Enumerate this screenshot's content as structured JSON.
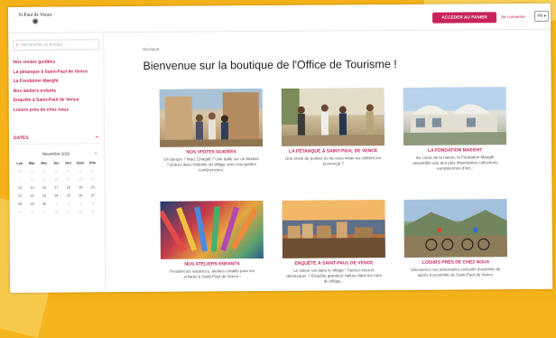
{
  "header": {
    "logo_text": "St Paul de Vence",
    "basket_button": "ACCÉDER AU PANIER",
    "login_link": "Se connecter",
    "language": "FR ▾"
  },
  "sidebar": {
    "search_placeholder": "Rechercher un produit",
    "nav_items": [
      "Nos visites guidées",
      "La pétanque à Saint-Paul de Vence",
      "La Fondation Maeght",
      "Nos ateliers enfants",
      "Enquête à Saint-Paul de Vence",
      "Loisirs près de chez nous"
    ],
    "dates_label": "DATES",
    "dates_toggle": "−",
    "calendar": {
      "month": "Novembre 2022",
      "next": "›",
      "weekdays": [
        "Lun",
        "Mar",
        "Mer",
        "Jeu",
        "Ven",
        "Sam",
        "Dim"
      ],
      "weeks": [
        [
          "31",
          "1",
          "2",
          "3",
          "4",
          "5",
          "6"
        ],
        [
          "7",
          "8",
          "9",
          "10",
          "11",
          "12",
          "13"
        ],
        [
          "14",
          "15",
          "16",
          "17",
          "18",
          "19",
          "20"
        ],
        [
          "21",
          "22",
          "23",
          "24",
          "25",
          "26",
          "27"
        ],
        [
          "28",
          "29",
          "30",
          "1",
          "2",
          "3",
          "4"
        ],
        [
          "5",
          "6",
          "7",
          "8",
          "9",
          "10",
          "11"
        ]
      ]
    }
  },
  "main": {
    "breadcrumb": "Boutique",
    "title": "Bienvenue sur la boutique de l'Office de Tourisme !",
    "cards": [
      {
        "title": "NOS VISITES GUIDÉES",
        "desc": "Un donjon ? Marc Chagall ? Une dalle sur un bastion ? Entrez dans l'intimité du village avec nos guides conférenciers."
      },
      {
        "title": "LA PÉTANQUE À SAINT-PAUL DE VENCE",
        "desc": "Une envie de pointer ou de vous initier au célèbre jeu provençal ?"
      },
      {
        "title": "LA FONDATION MAEGHT",
        "desc": "Au coeur de la nature, la Fondation Maeght rassemble une des plus importantes collections européennes d'Art..."
      },
      {
        "title": "NOS ATELIERS ENFANTS",
        "desc": "Pendant les vacances, ateliers créatifs pour les enfants à Saint-Paul de Vence !"
      },
      {
        "title": "ENQUÊTE À SAINT-PAUL DE VENCE",
        "desc": "Le voleur est dans le village ! Saurez-vous le démasquer ? Enquête grandeur nature dans les rues du village..."
      },
      {
        "title": "LOISIRS PRÈS DE CHEZ NOUS",
        "desc": "Découvrez nos partenaires exclusifs d'activités de loisirs à proximité de Saint-Paul de Vence."
      }
    ]
  },
  "colors": {
    "accent": "#c8245b",
    "background_yellow": "#f3b21a"
  }
}
